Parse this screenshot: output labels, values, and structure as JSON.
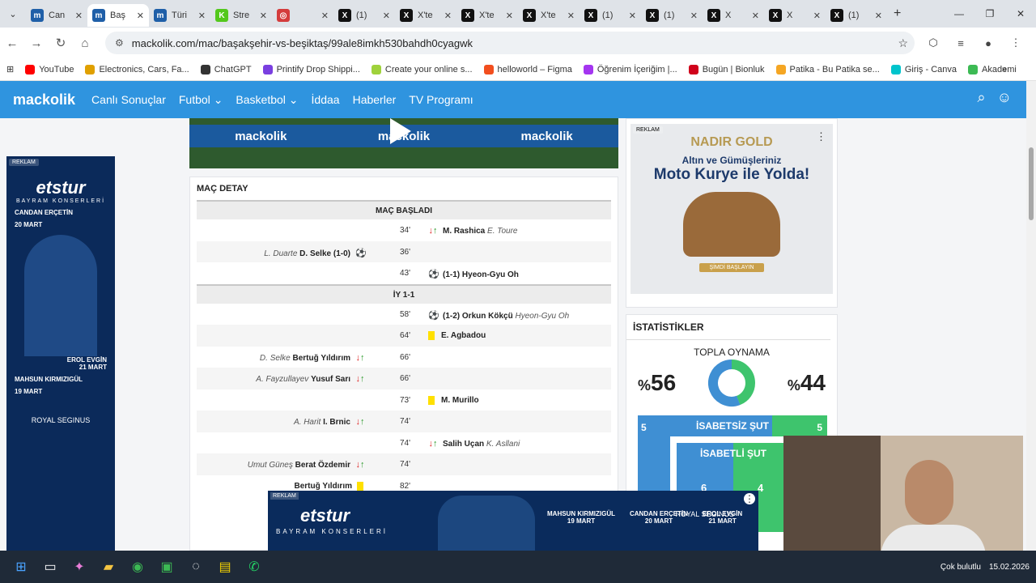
{
  "browser": {
    "tabs": [
      {
        "label": "Can",
        "fav": "m",
        "color": "#1f5fa8",
        "active": false
      },
      {
        "label": "Baş",
        "fav": "m",
        "color": "#1f5fa8",
        "active": true
      },
      {
        "label": "Türi",
        "fav": "m",
        "color": "#1f5fa8",
        "active": false
      },
      {
        "label": "Stre",
        "fav": "K",
        "color": "#53c81c",
        "active": false
      },
      {
        "label": "",
        "fav": "◎",
        "color": "#d43c3c",
        "active": false
      },
      {
        "label": "(1)",
        "fav": "X",
        "color": "#111111",
        "active": false
      },
      {
        "label": "X'te",
        "fav": "X",
        "color": "#111111",
        "active": false
      },
      {
        "label": "X'te",
        "fav": "X",
        "color": "#111111",
        "active": false
      },
      {
        "label": "X'te",
        "fav": "X",
        "color": "#111111",
        "active": false
      },
      {
        "label": "(1)",
        "fav": "X",
        "color": "#111111",
        "active": false
      },
      {
        "label": "(1)",
        "fav": "X",
        "color": "#111111",
        "active": false
      },
      {
        "label": "X",
        "fav": "X",
        "color": "#111111",
        "active": false
      },
      {
        "label": "X",
        "fav": "X",
        "color": "#111111",
        "active": false
      },
      {
        "label": "(1)",
        "fav": "X",
        "color": "#111111",
        "active": false
      }
    ],
    "url": "mackolik.com/mac/başakşehir-vs-beşiktaş/99ale8imkh530bahdh0cyagwk",
    "bookmarks": [
      "YouTube",
      "Electronics, Cars, Fa...",
      "ChatGPT",
      "Printify Drop Shippi...",
      "Create your online s...",
      "helloworld – Figma",
      "Öğrenim İçeriğim |...",
      "Bugün | Bionluk",
      "Patika - Bu Patika se...",
      "Giriş - Canva",
      "Akademi"
    ]
  },
  "site": {
    "logo": "mackolik",
    "nav": [
      "Canlı Sonuçlar",
      "Futbol",
      "Basketbol",
      "İddaa",
      "Haberler",
      "TV Programı"
    ],
    "video_brand": "mackolik"
  },
  "ads": {
    "reklam": "REKLAM",
    "left": {
      "brand": "etstur",
      "sub": "BAYRAM KONSERLERİ",
      "p1": "CANDAN ERÇETİN",
      "d1": "20 MART",
      "p2": "EROL EVGİN",
      "d2": "21 MART",
      "p3": "MAHSUN KIRMIZIGÜL",
      "d3": "19 MART",
      "crest": "ROYAL SEGINUS"
    },
    "right": {
      "brand": "NADIR GOLD",
      "line1": "Altın ve Gümüşleriniz",
      "line2": "Moto Kurye ile Yolda!",
      "cta": "ŞİMDİ BAŞLAYIN"
    },
    "bottom": {
      "brand": "etstur",
      "sub": "BAYRAM KONSERLERİ",
      "n1": "MAHSUN KIRMIZIGÜL",
      "n1d": "19 MART",
      "n2": "CANDAN ERÇETİN",
      "n2d": "20 MART",
      "n3": "EROL EVGİN",
      "n3d": "21 MART",
      "crest": "ROYAL SEGINUS"
    }
  },
  "match": {
    "title": "MAÇ DETAY",
    "sections": {
      "start": "MAÇ BAŞLADI",
      "half": "İY 1-1"
    },
    "events": [
      {
        "min": "34'",
        "side": "R",
        "type": "sub",
        "player": "M. Rashica",
        "other": "E. Toure",
        "score": ""
      },
      {
        "min": "36'",
        "side": "L",
        "type": "goal",
        "player": "D. Selke",
        "other": "L. Duarte",
        "score": "(1-0)"
      },
      {
        "min": "43'",
        "side": "R",
        "type": "goal",
        "player": "Hyeon-Gyu Oh",
        "other": "",
        "score": "(1-1)"
      },
      {
        "min": "58'",
        "side": "R",
        "type": "goal",
        "player": "Orkun Kökçü",
        "other": "Hyeon-Gyu Oh",
        "score": "(1-2)"
      },
      {
        "min": "64'",
        "side": "R",
        "type": "yellow",
        "player": "E. Agbadou",
        "other": "",
        "score": ""
      },
      {
        "min": "66'",
        "side": "L",
        "type": "sub",
        "player": "Bertuğ Yıldırım",
        "other": "D. Selke",
        "score": ""
      },
      {
        "min": "66'",
        "side": "L",
        "type": "sub",
        "player": "Yusuf Sarı",
        "other": "A. Fayzullayev",
        "score": ""
      },
      {
        "min": "73'",
        "side": "R",
        "type": "yellow",
        "player": "M. Murillo",
        "other": "",
        "score": ""
      },
      {
        "min": "74'",
        "side": "L",
        "type": "sub",
        "player": "I. Brnic",
        "other": "A. Harit",
        "score": ""
      },
      {
        "min": "74'",
        "side": "R",
        "type": "sub",
        "player": "Salih Uçan",
        "other": "K. Asllani",
        "score": ""
      },
      {
        "min": "74'",
        "side": "L",
        "type": "sub",
        "player": "Berat Özdemir",
        "other": "Umut Güneş",
        "score": ""
      },
      {
        "min": "82'",
        "side": "L",
        "type": "yellow",
        "player": "Bertuğ Yıldırım",
        "other": "",
        "score": ""
      }
    ]
  },
  "stats": {
    "title": "İSTATİSTİKLER",
    "possession_label": "TOPLA OYNAMA",
    "home_pct_symbol": "%",
    "home_pct": "56",
    "away_pct_symbol": "%",
    "away_pct": "44",
    "home_color": "#3f8fd3",
    "away_color": "#3ec46d",
    "off_target_label": "İSABETSİZ ŞUT",
    "off_target_home": "5",
    "off_target_away": "5",
    "on_target_label": "İSABETLİ ŞUT",
    "on_target_home": "6",
    "on_target_away": "4"
  },
  "taskbar": {
    "status": "Çok bulutlu",
    "date": "15.02.2026"
  }
}
